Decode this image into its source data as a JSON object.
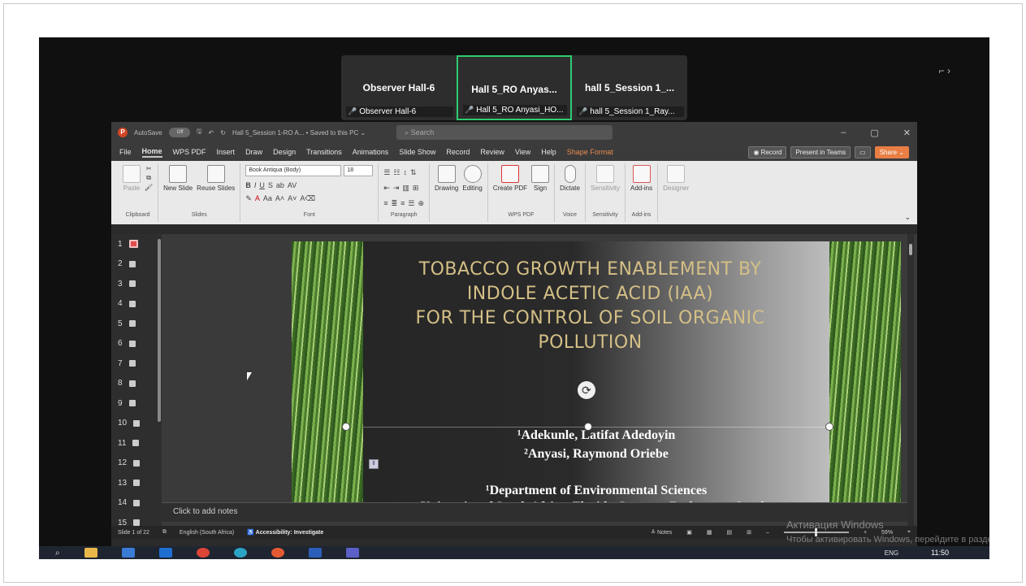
{
  "meeting": {
    "tiles": [
      {
        "name": "Observer Hall-6",
        "sub": "Observer Hall-6",
        "active": false
      },
      {
        "name": "Hall 5_RO Anyas...",
        "sub": "Hall 5_RO Anyasi_HO...",
        "active": true
      },
      {
        "name": "hall 5_Session 1_...",
        "sub": "hall 5_Session 1_Ray...",
        "active": false
      }
    ]
  },
  "ppt": {
    "autosave_label": "AutoSave",
    "autosave_state": "Off",
    "title": "Hall 5_Session 1-RO A...  •  Saved to this PC ⌄",
    "search_placeholder": "Search",
    "tabs": [
      "File",
      "Home",
      "WPS PDF",
      "Insert",
      "Draw",
      "Design",
      "Transitions",
      "Animations",
      "Slide Show",
      "Record",
      "Review",
      "View",
      "Help",
      "Shape Format"
    ],
    "active_tab": "Home",
    "record_btn": "Record",
    "present_btn": "Present in Teams",
    "share_btn": "Share",
    "ribbon": {
      "clipboard": {
        "label": "Clipboard",
        "paste": "Paste"
      },
      "slides": {
        "label": "Slides",
        "new_slide": "New Slide",
        "reuse": "Reuse Slides"
      },
      "font": {
        "label": "Font",
        "font_name": "Book Antiqua (Body)",
        "font_size": "18"
      },
      "paragraph": {
        "label": "Paragraph"
      },
      "drawing": "Drawing",
      "editing": "Editing",
      "wps": {
        "label": "WPS PDF",
        "create_pdf": "Create PDF",
        "sign": "Sign"
      },
      "voice": {
        "label": "Voice",
        "dictate": "Dictate"
      },
      "sensitivity": {
        "label": "Sensitivity",
        "btn": "Sensitivity"
      },
      "addins": {
        "label": "Add-ins",
        "btn": "Add-ins"
      },
      "designer": "Designer"
    },
    "thumbnails": [
      "1",
      "2",
      "3",
      "4",
      "5",
      "6",
      "7",
      "8",
      "9",
      "10",
      "11",
      "12",
      "13",
      "14",
      "15"
    ],
    "slide": {
      "title_lines": [
        "TOBACCO GROWTH ENABLEMENT BY",
        "INDOLE ACETIC ACID  (IAA)",
        "FOR THE CONTROL OF SOIL ORGANIC",
        "POLLUTION"
      ],
      "author1": "¹Adekunle, Latifat Adedoyin",
      "author2": "²Anyasi, Raymond Oriebe",
      "dept": "¹Department of Environmental Sciences",
      "univ": "University of South Africa, Florida Campus, Rodepoort, South"
    },
    "notes_placeholder": "Click to add notes",
    "status": {
      "slide_count": "Slide 1 of 22",
      "language": "English (South Africa)",
      "accessibility": "Accessibility: Investigate",
      "notes": "Notes",
      "zoom": "59%"
    }
  },
  "watermark": {
    "line1": "Активация Windows",
    "line2": "Чтобы активировать Windows, перейдите в раздел \"Параметры\"."
  },
  "taskbar": {
    "time": "11:50",
    "lang": "ENG"
  }
}
